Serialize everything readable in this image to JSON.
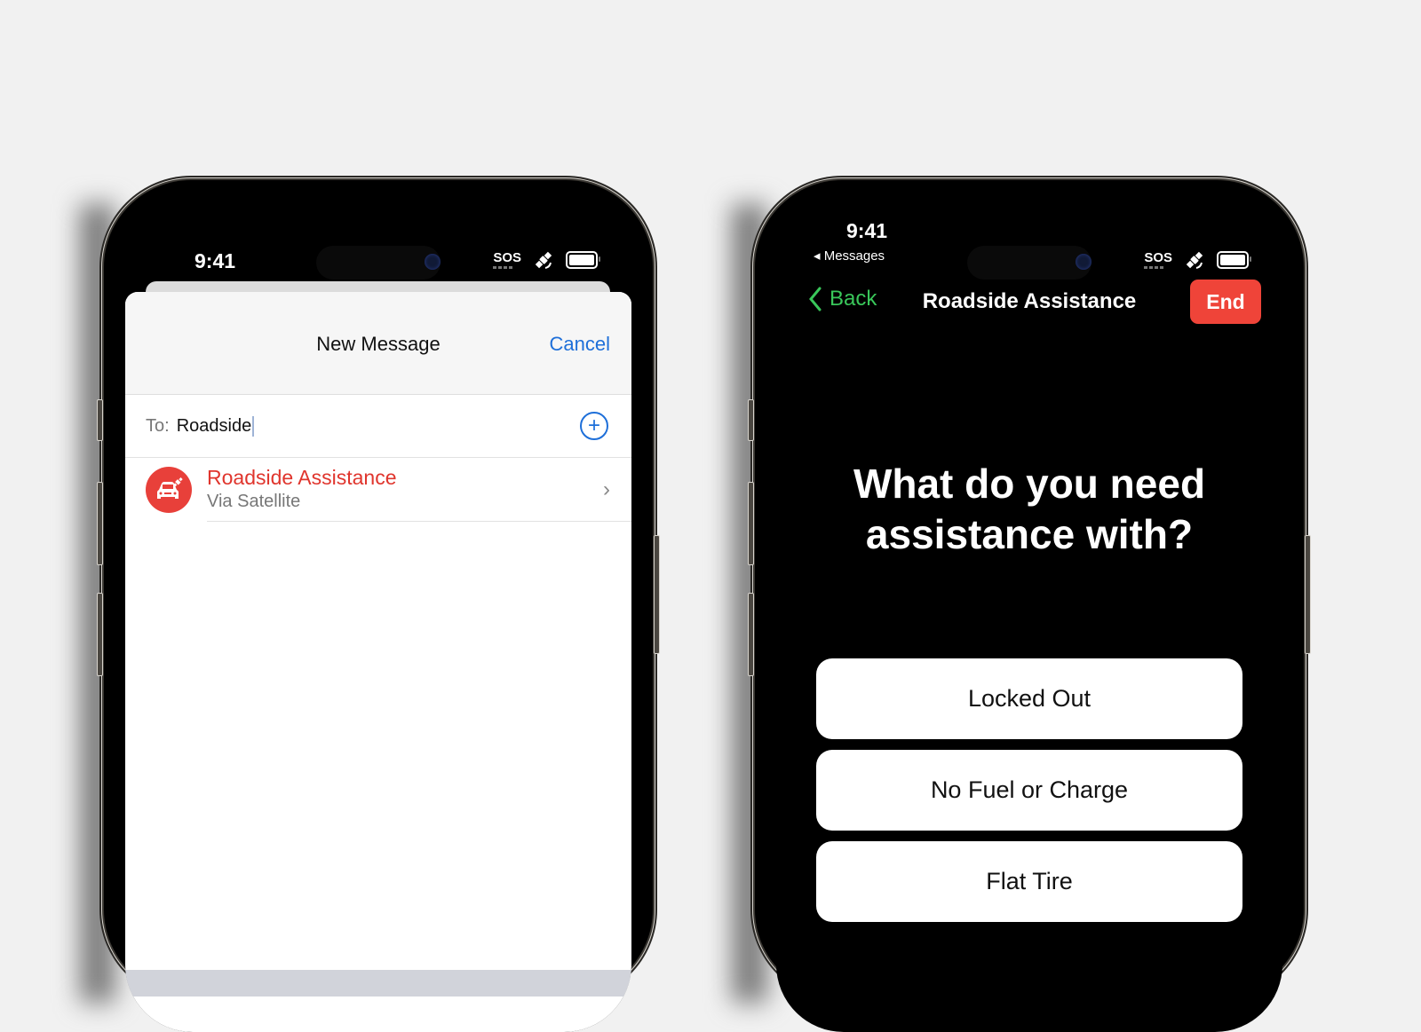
{
  "left_phone": {
    "status": {
      "time": "9:41",
      "sos": "SOS",
      "satellite_icon": "satellite-icon",
      "battery_icon": "battery-icon"
    },
    "sheet": {
      "title": "New Message",
      "cancel_label": "Cancel",
      "to_label": "To:",
      "to_value": "Roadside",
      "add_icon": "+",
      "suggestion": {
        "name": "Roadside Assistance",
        "subtitle": "Via Satellite",
        "chevron": "›"
      }
    }
  },
  "right_phone": {
    "status": {
      "time": "9:41",
      "back_app": "◂ Messages",
      "sos": "SOS"
    },
    "nav": {
      "back_label": "Back",
      "title": "Roadside Assistance",
      "end_label": "End"
    },
    "question_line1": "What do you need",
    "question_line2": "assistance with?",
    "options": [
      {
        "label": "Locked Out"
      },
      {
        "label": "No Fuel or Charge"
      },
      {
        "label": "Flat Tire"
      }
    ]
  },
  "colors": {
    "accent_blue": "#1e6fd9",
    "alert_red": "#ef4439",
    "back_green": "#39c75a"
  }
}
